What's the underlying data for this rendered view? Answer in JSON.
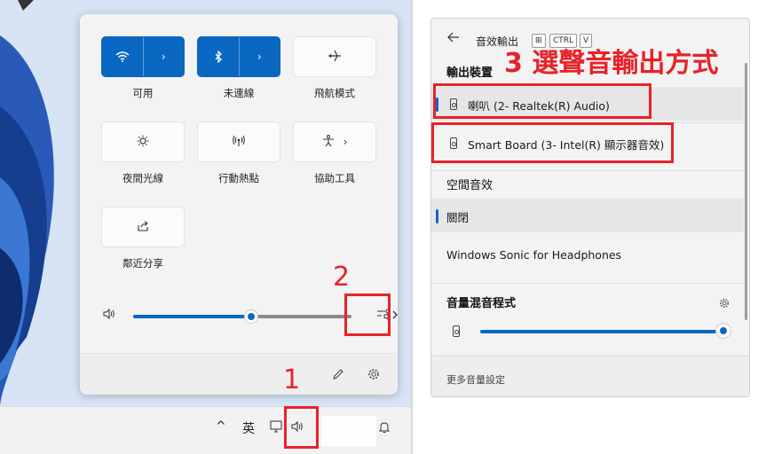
{
  "quick_settings": {
    "tiles": [
      {
        "label": "可用",
        "icon": "wifi-icon",
        "active": true,
        "has_arrow": true
      },
      {
        "label": "未連線",
        "icon": "bluetooth-icon",
        "active": true,
        "has_arrow": true
      },
      {
        "label": "飛航模式",
        "icon": "airplane-icon",
        "active": false,
        "has_arrow": false
      },
      {
        "label": "夜間光線",
        "icon": "night-light-icon",
        "active": false,
        "has_arrow": false
      },
      {
        "label": "行動熱點",
        "icon": "hotspot-icon",
        "active": false,
        "has_arrow": false
      },
      {
        "label": "協助工具",
        "icon": "accessibility-icon",
        "active": false,
        "has_arrow": true
      },
      {
        "label": "鄰近分享",
        "icon": "share-icon",
        "active": false,
        "has_arrow": false
      }
    ],
    "volume_level": 0.54,
    "volume_icon": "speaker-icon",
    "mixer_icon": "sound-output-icon"
  },
  "taskbar": {
    "chevron": "^",
    "ime": "英",
    "speaker_icon": "speaker-icon"
  },
  "annotations": {
    "step1": "1",
    "step2": "2",
    "step3": "3 選聲音輸出方式"
  },
  "sound_panel": {
    "title": "音效輸出",
    "shortcut": [
      "⊞",
      "CTRL",
      "V"
    ],
    "output_heading": "輸出裝置",
    "devices": [
      {
        "name": "喇叭 (2- Realtek(R) Audio)",
        "selected": true
      },
      {
        "name": "Smart Board (3- Intel(R) 顯示器音效)",
        "selected": false
      }
    ],
    "spatial_heading": "空間音效",
    "spatial_options": [
      {
        "name": "關閉",
        "selected": true
      },
      {
        "name": "Windows Sonic for Headphones",
        "selected": false
      }
    ],
    "mixer_heading": "音量混音程式",
    "mixer_level": 1.0,
    "more_settings": "更多音量設定"
  },
  "colors": {
    "accent": "#0a67c2",
    "annotation": "#e8222a"
  }
}
